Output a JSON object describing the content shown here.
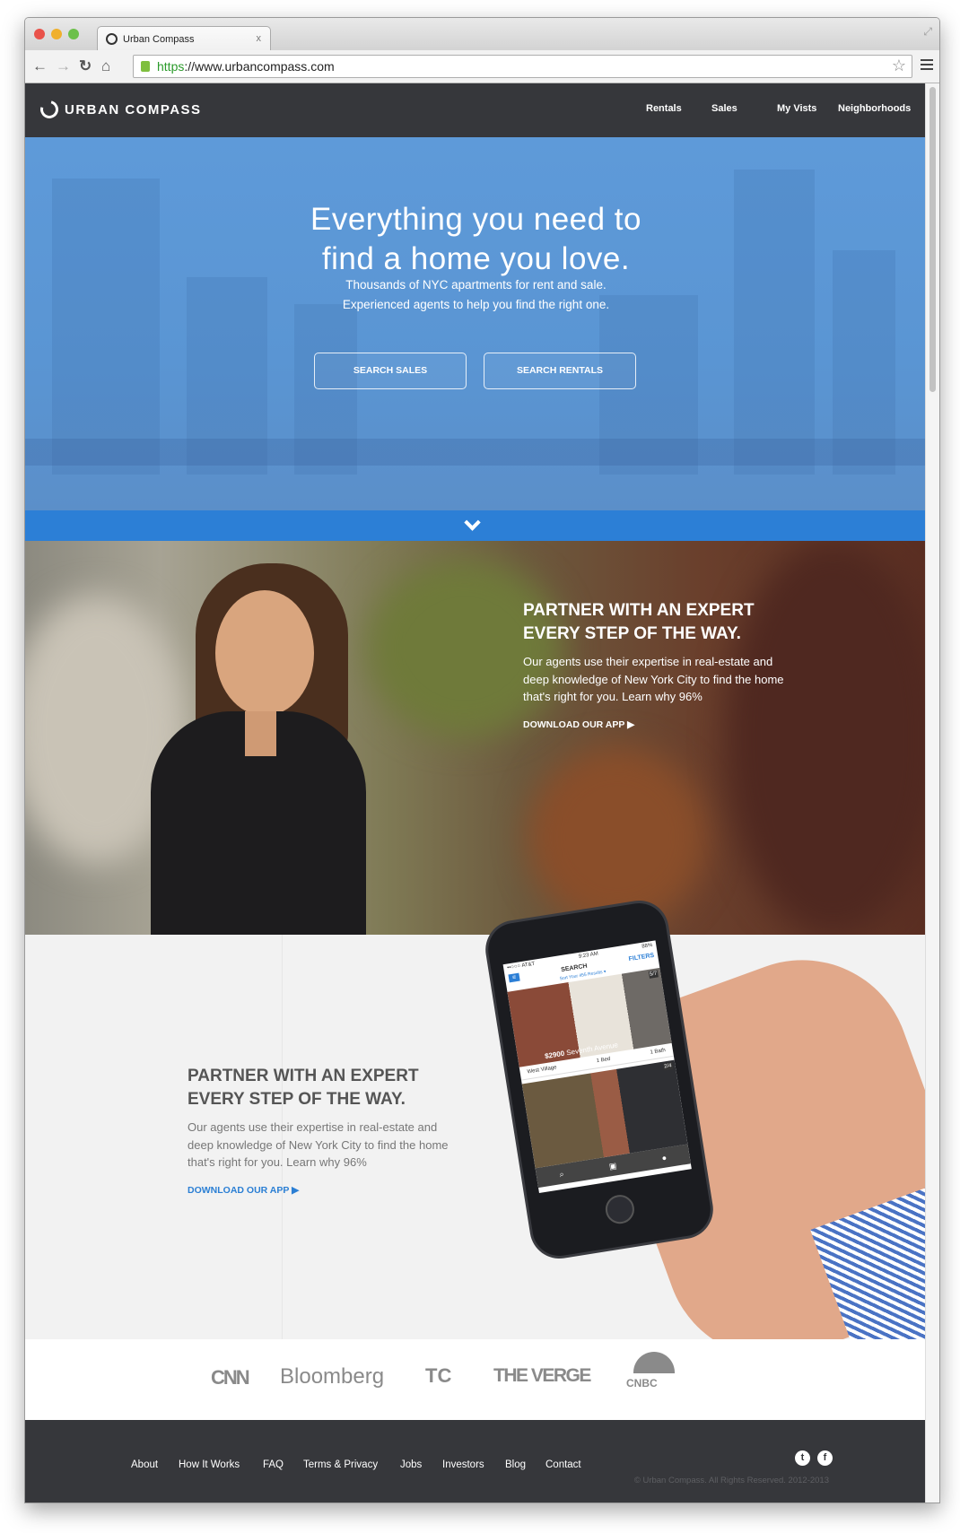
{
  "browser": {
    "tab_title": "Urban Compass",
    "tab_close": "x",
    "url_scheme": "https",
    "url_rest": "://www.urbancompass.com"
  },
  "nav": {
    "logo": "URBAN COMPASS",
    "links": [
      "Rentals",
      "Sales",
      "My Vists",
      "Neighborhoods"
    ]
  },
  "hero": {
    "headline_1": "Everything you need to",
    "headline_2": "find a home you love.",
    "sub_1": "Thousands of NYC apartments for rent and sale.",
    "sub_2": "Experienced agents to help you find the right one.",
    "btn_sales": "SEARCH SALES",
    "btn_rentals": "SEARCH RENTALS"
  },
  "feature1": {
    "heading_1": "PARTNER WITH AN EXPERT",
    "heading_2": "EVERY STEP OF THE WAY.",
    "body": "Our agents use their expertise in real-estate and deep knowledge of New York City to find the home that's right for you. Learn why 96%",
    "link": "DOWNLOAD OUR APP"
  },
  "feature2": {
    "heading_1": "PARTNER WITH AN EXPERT",
    "heading_2": "EVERY STEP OF THE WAY.",
    "body": "Our agents use their expertise in real-estate and deep knowledge of New York City to find the home that's right for you. Learn why 96%",
    "link": "DOWNLOAD OUR APP"
  },
  "phone": {
    "carrier": "••○○○ AT&T",
    "time": "9:23 AM",
    "battery": "88%",
    "title": "SEARCH",
    "filters": "FILTERS",
    "sort": "Sort Your 455 Results ▾",
    "listing1": {
      "count": "5/7",
      "price": "$2900",
      "street": "Seventh Avenue",
      "hood": "West Village",
      "beds": "1 Bed",
      "baths": "1 Bath"
    },
    "listing2": {
      "count": "2/4"
    }
  },
  "press": [
    "CNN",
    "Bloomberg",
    "TC",
    "THE VERGE",
    "CNBC"
  ],
  "footer": {
    "links": [
      "About",
      "How It Works",
      "FAQ",
      "Terms & Privacy",
      "Jobs",
      "Investors",
      "Blog",
      "Contact"
    ],
    "copyright": "© Urban Compass. All Rights Reserved. 2012-2013",
    "social": [
      "twitter",
      "facebook"
    ]
  }
}
